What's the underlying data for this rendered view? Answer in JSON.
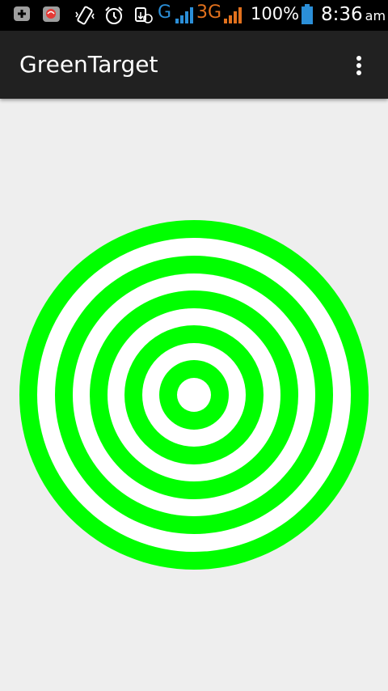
{
  "status_bar": {
    "icons": [
      "add-box-icon",
      "app-notification-icon",
      "vibrate-icon",
      "alarm-icon",
      "data-transfer-icon",
      "signal-icon",
      "signal-icon"
    ],
    "network_1": "G",
    "network_2": "3G",
    "battery_percent": "100%",
    "time": "8:36",
    "ampm": "am"
  },
  "app_bar": {
    "title": "GreenTarget",
    "overflow_icon": "more-vert-icon"
  },
  "target": {
    "ring_color": "#00ff00",
    "gap_color": "#ffffff",
    "ring_count": 5
  }
}
